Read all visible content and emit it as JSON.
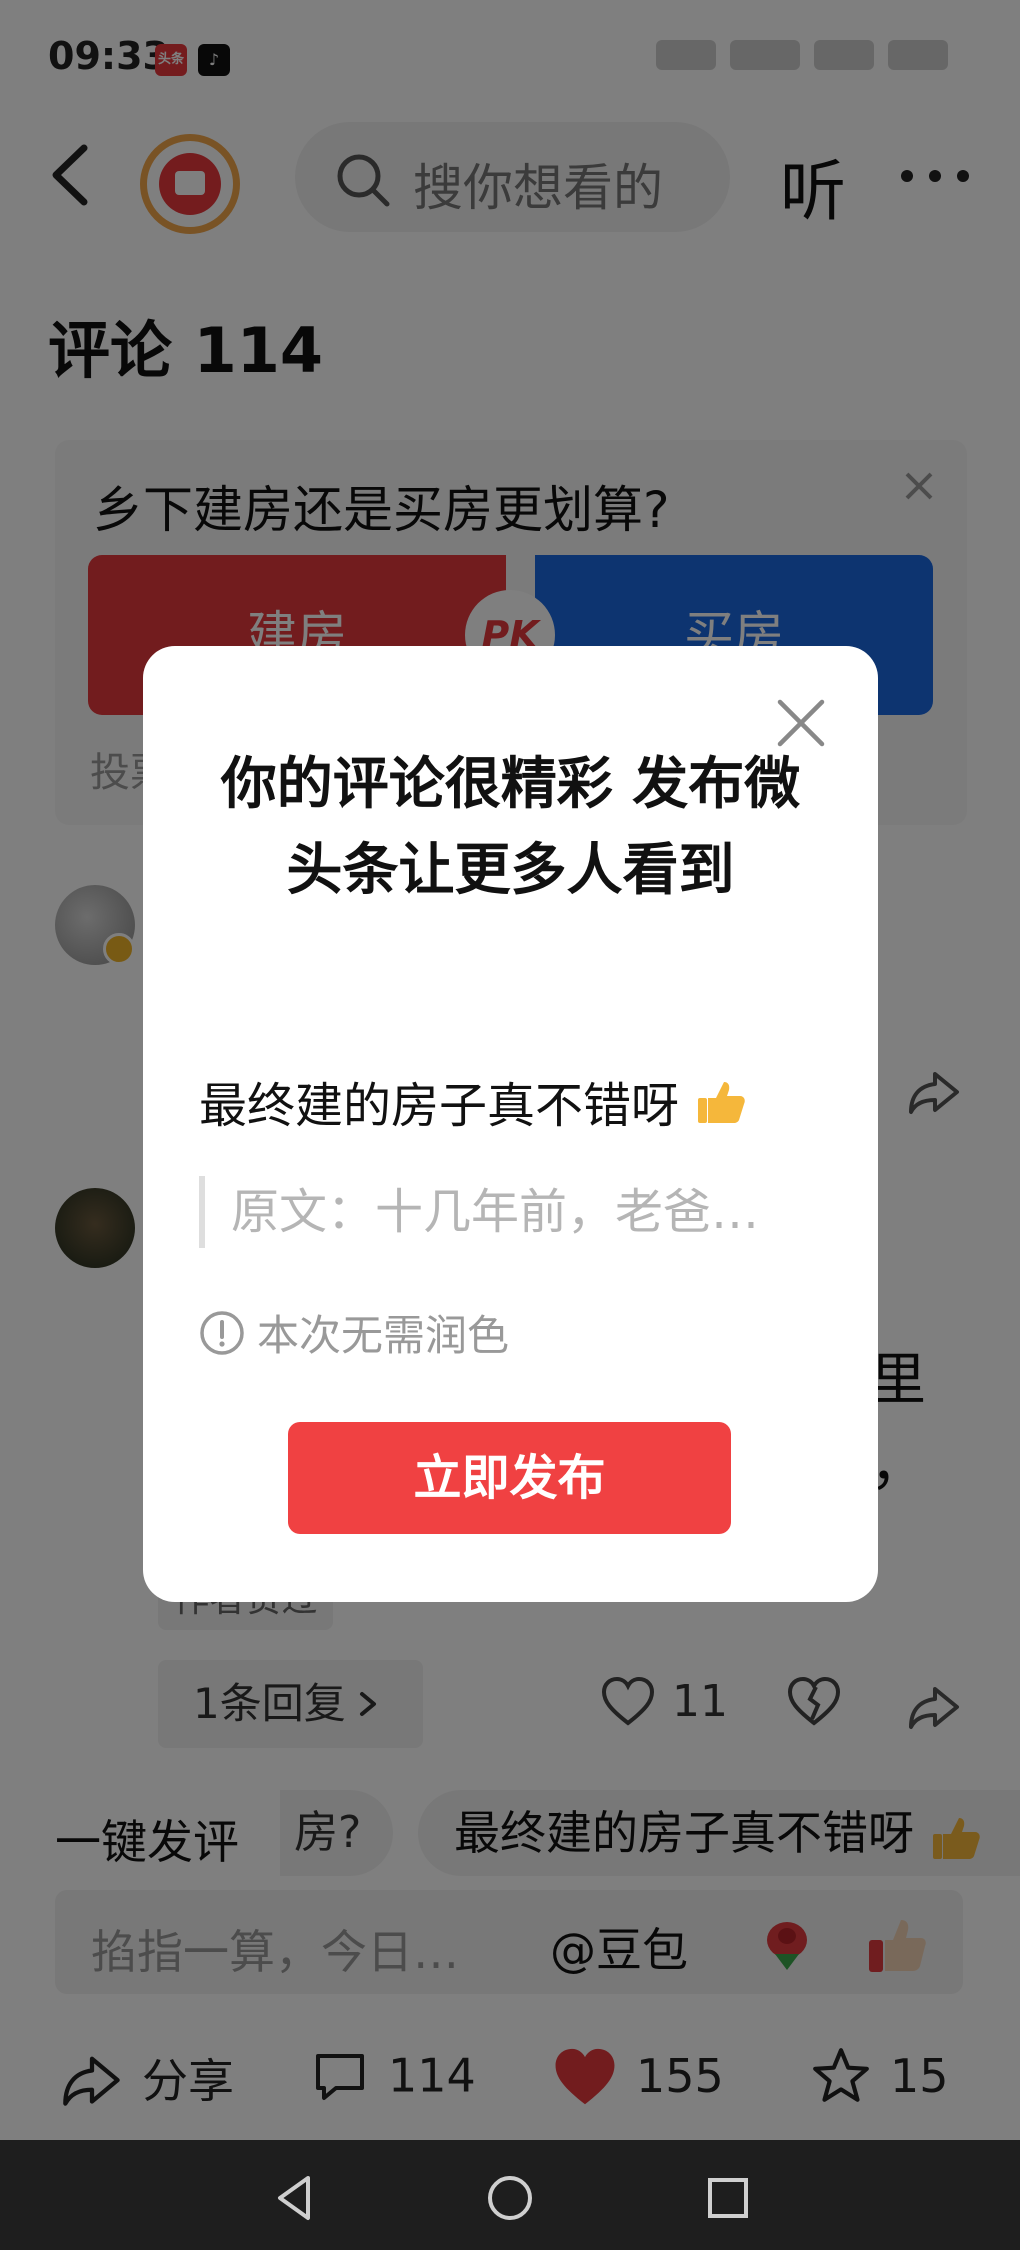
{
  "status_bar": {
    "time": "09:33",
    "app_badges": [
      "头条",
      "抖音"
    ]
  },
  "nav": {
    "search_placeholder": "搜你想看的",
    "listen_label": "听"
  },
  "comments": {
    "title": "评论 114",
    "author_liked_tag": "作者赞过",
    "reply_button": "1条回复",
    "like_count": "11",
    "partial_text_tail_1": "里",
    "partial_text_tail_2": "，"
  },
  "poll": {
    "question": "乡下建房还是买房更划算?",
    "option_left": "建房",
    "option_right": "买房",
    "vs_badge": "PK",
    "footer_partial": "投票"
  },
  "quick_reply": {
    "label": "一键发评",
    "chip_partial": "房?",
    "chip_suggestion": "最终建的房子真不错呀"
  },
  "comment_input": {
    "placeholder": "掐指一算，今日…",
    "mention": "@豆包"
  },
  "action_bar": {
    "share_label": "分享",
    "comment_count": "114",
    "like_count": "155",
    "favorite_count": "15"
  },
  "modal": {
    "title": "你的评论很精彩 发布微头条让更多人看到",
    "polished_text": "最终建的房子真不错呀",
    "original_quote": "原文：十几年前，老爸…",
    "notice": "本次无需润色",
    "publish_button": "立即发布"
  },
  "colors": {
    "accent_red": "#f04142",
    "poll_red": "#e4393c",
    "poll_blue": "#1a68e0",
    "like_red": "#e4393c",
    "avatar_ring": "#f2a64a"
  },
  "icons": [
    "back-arrow-icon",
    "search-icon",
    "more-dots-icon",
    "close-icon",
    "share-icon",
    "comment-icon",
    "heart-icon",
    "dislike-heart-icon",
    "star-icon",
    "info-icon",
    "chevron-right-icon",
    "thumbs-up-emoji",
    "rose-emoji",
    "nav-back-icon",
    "nav-home-icon",
    "nav-recents-icon"
  ]
}
